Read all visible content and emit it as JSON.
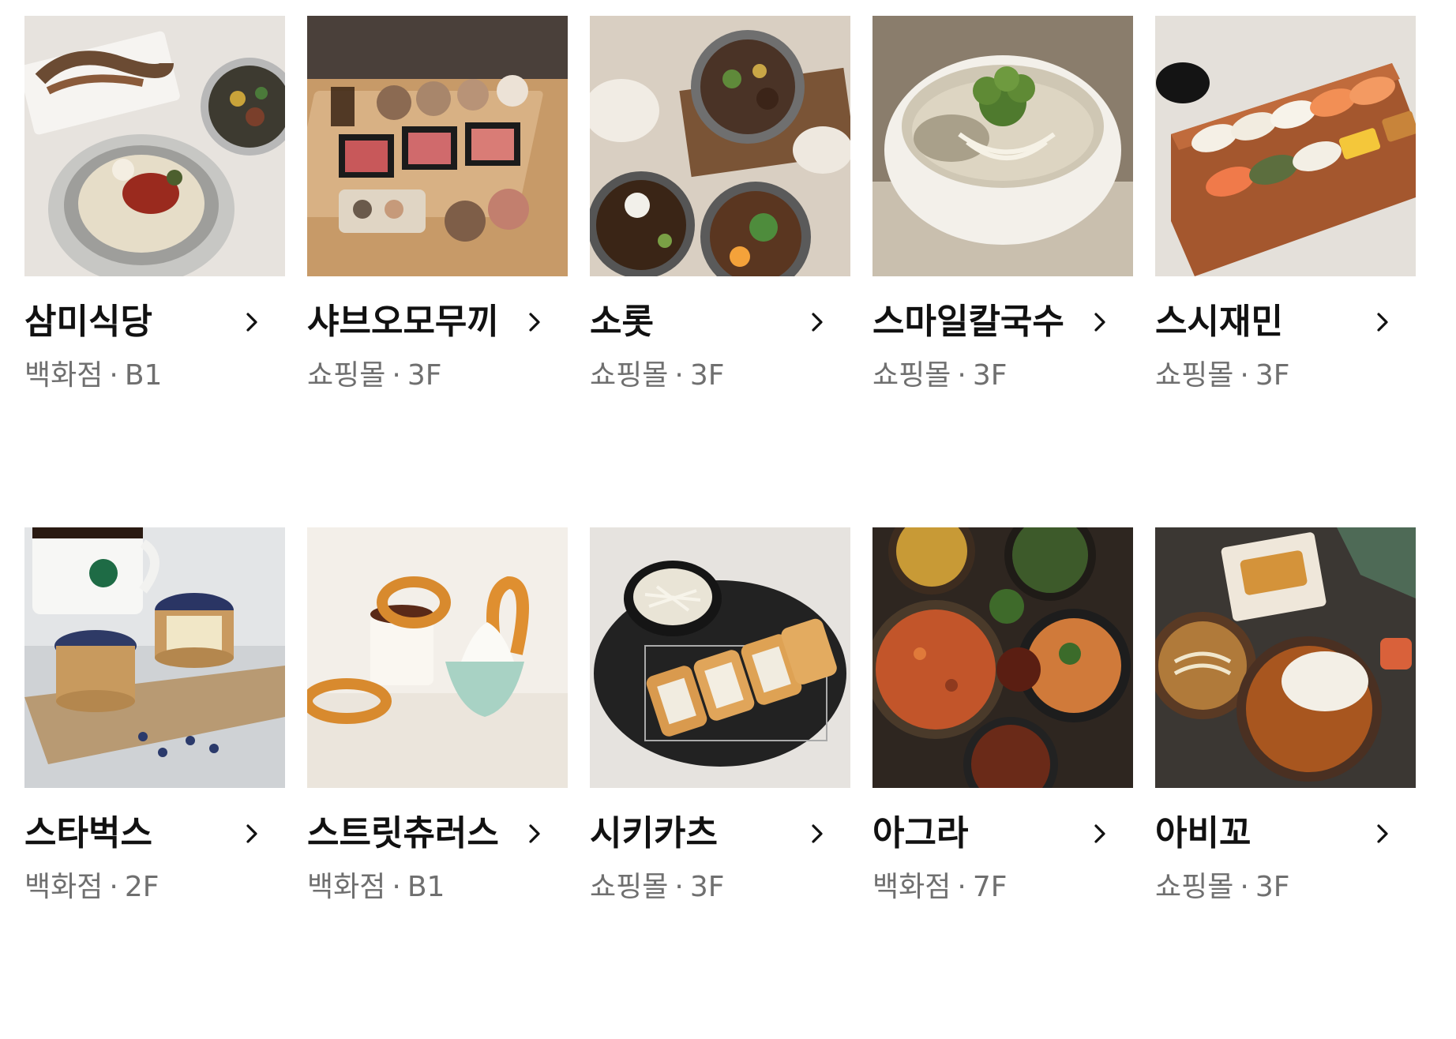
{
  "restaurants": [
    {
      "name": "삼미식당",
      "building": "백화점",
      "floor": "B1",
      "image": "bibim-noodle-bowls"
    },
    {
      "name": "샤브오모무끼",
      "building": "쇼핑몰",
      "floor": "3F",
      "image": "shabu-shabu-spread"
    },
    {
      "name": "소롯",
      "building": "쇼핑몰",
      "floor": "3F",
      "image": "pot-rice-dishes"
    },
    {
      "name": "스마일칼국수",
      "building": "쇼핑몰",
      "floor": "3F",
      "image": "kalguksu-bowl"
    },
    {
      "name": "스시재민",
      "building": "쇼핑몰",
      "floor": "3F",
      "image": "sushi-board"
    },
    {
      "name": "스타벅스",
      "building": "백화점",
      "floor": "2F",
      "image": "blueberry-cheesecake-coffee"
    },
    {
      "name": "스트릿츄러스",
      "building": "백화점",
      "floor": "B1",
      "image": "churros-ice-cream"
    },
    {
      "name": "시키카츠",
      "building": "쇼핑몰",
      "floor": "3F",
      "image": "tonkatsu-plate"
    },
    {
      "name": "아그라",
      "building": "백화점",
      "floor": "7F",
      "image": "indian-curry-spread"
    },
    {
      "name": "아비꼬",
      "building": "쇼핑몰",
      "floor": "3F",
      "image": "curry-udon-spread"
    }
  ],
  "separator": "·",
  "icons": {
    "chevron": "chevron-right-icon"
  }
}
